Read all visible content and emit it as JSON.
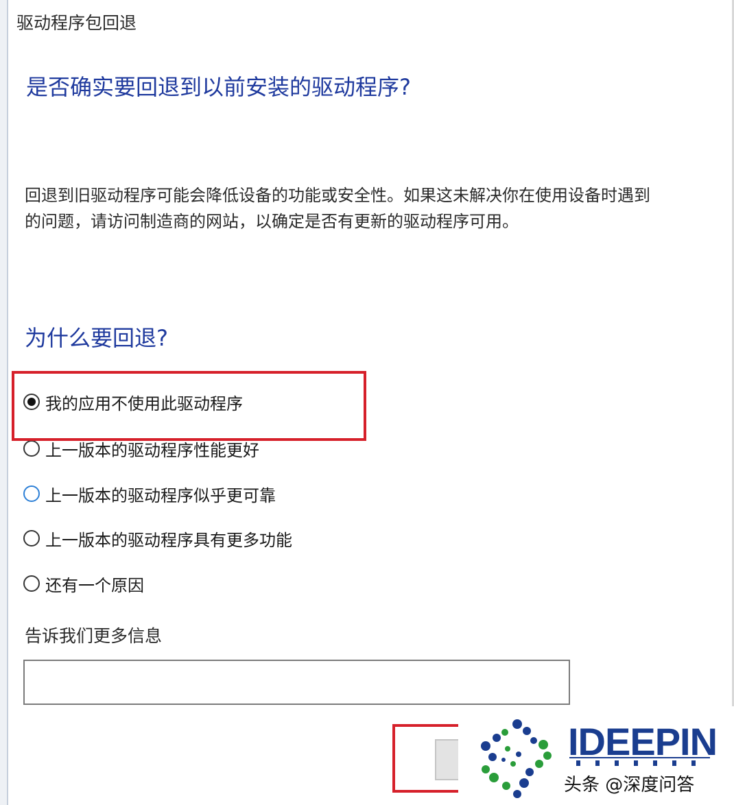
{
  "dialog": {
    "title": "驱动程序包回退"
  },
  "question": {
    "heading": "是否确实要回退到以前安装的驱动程序?"
  },
  "description": {
    "text": "回退到旧驱动程序可能会降低设备的功能或安全性。如果这未解决你在使用设备时遇到的问题，请访问制造商的网站，以确定是否有更新的驱动程序可用。"
  },
  "reasons": {
    "heading": "为什么要回退?",
    "options": [
      {
        "label": "我的应用不使用此驱动程序",
        "selected": true
      },
      {
        "label": "上一版本的驱动程序性能更好",
        "selected": false
      },
      {
        "label": "上一版本的驱动程序似乎更可靠",
        "selected": false,
        "hovered": true
      },
      {
        "label": "上一版本的驱动程序具有更多功能",
        "selected": false
      },
      {
        "label": "还有一个原因",
        "selected": false
      }
    ]
  },
  "more_info": {
    "label": "告诉我们更多信息",
    "value": ""
  },
  "annotations": {
    "highlight_color": "#d6202a"
  },
  "watermark": {
    "logo_text": "IDEEPIN",
    "credit": "头条 @深度问答",
    "logo_color": "#1a3d8f"
  },
  "colors": {
    "heading_blue": "#1f3a9e",
    "hover_blue": "#2c7fd6"
  }
}
